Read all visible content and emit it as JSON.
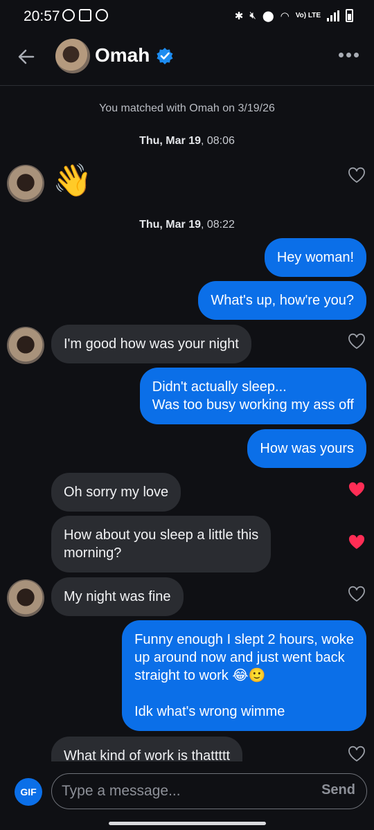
{
  "status_bar": {
    "time": "20:57",
    "lte_label": "Vo) LTE"
  },
  "header": {
    "name": "Omah"
  },
  "match_notice": "You matched with Omah on 3/19/26",
  "timestamps": [
    {
      "day": "Thu, Mar 19",
      "time": ", 08:06"
    },
    {
      "day": "Thu, Mar 19",
      "time": ", 08:22"
    }
  ],
  "messages": [
    {
      "text": "👋"
    },
    {
      "text": "Hey woman!"
    },
    {
      "text": "What's up, how're you?"
    },
    {
      "text": "I'm good how was your night"
    },
    {
      "text": "Didn't actually sleep...\nWas too busy working my ass off"
    },
    {
      "text": "How was yours"
    },
    {
      "text": "Oh sorry my love",
      "liked": true
    },
    {
      "text": "How about you sleep a little this\nmorning?",
      "liked": true
    },
    {
      "text": "My night was fine"
    },
    {
      "text": "Funny enough I slept 2 hours, woke\nup around now and just went back\nstraight to work 😂🙂\n\nIdk what's wrong wimme"
    },
    {
      "text": "What kind of work is thattttt"
    }
  ],
  "composer": {
    "gif_label": "GIF",
    "placeholder": "Type a message...",
    "send_label": "Send"
  },
  "colors": {
    "outgoing_bubble": "#0b6fe8",
    "incoming_bubble": "#2a2c31",
    "liked_heart": "#ff2d55",
    "background": "#0f1014"
  }
}
